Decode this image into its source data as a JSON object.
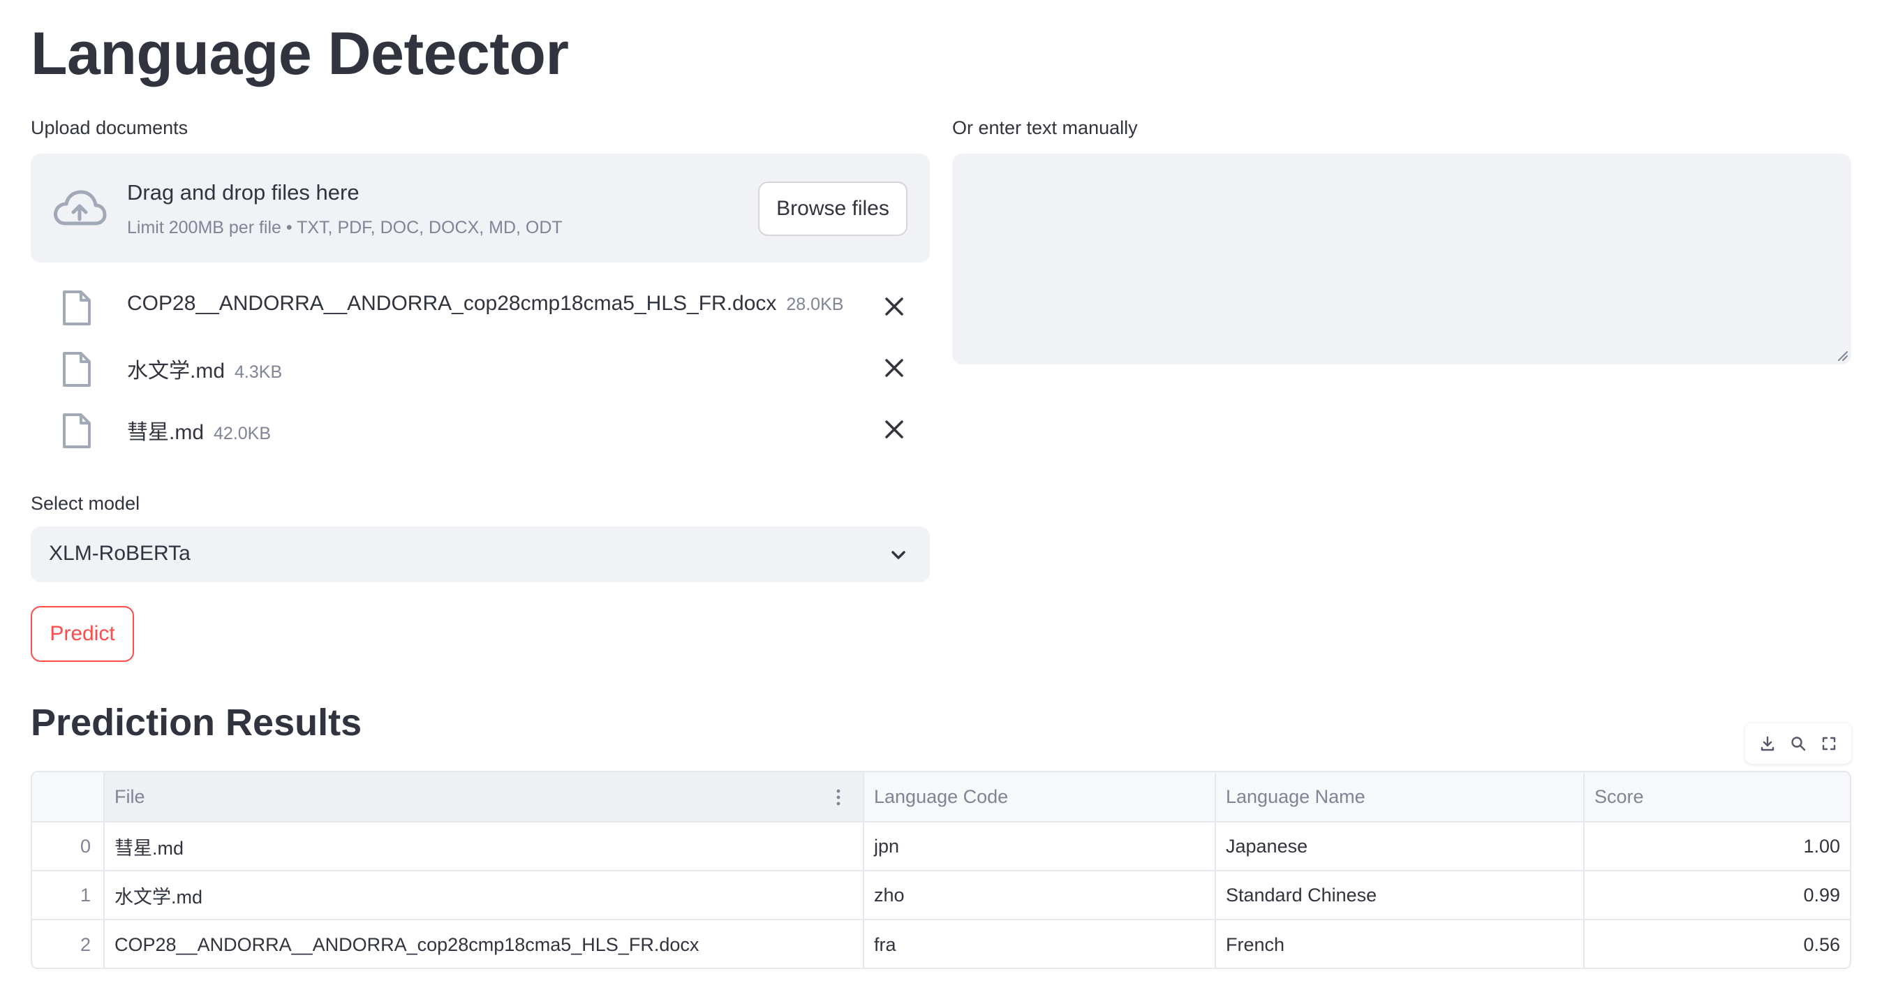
{
  "app": {
    "title": "Language Detector"
  },
  "upload": {
    "label": "Upload documents",
    "drop_text": "Drag and drop files here",
    "limit_text": "Limit 200MB per file • TXT, PDF, DOC, DOCX, MD, ODT",
    "browse_label": "Browse files",
    "icon": "cloud-upload-icon"
  },
  "files": [
    {
      "name": "COP28__ANDORRA__ANDORRA_cop28cmp18cma5_HLS_FR.docx",
      "size": "28.0KB"
    },
    {
      "name": "水文学.md",
      "size": "4.3KB"
    },
    {
      "name": "彗星.md",
      "size": "42.0KB"
    }
  ],
  "manual": {
    "label": "Or enter text manually",
    "value": ""
  },
  "model": {
    "label": "Select model",
    "selected": "XLM-RoBERTa"
  },
  "predict": {
    "label": "Predict"
  },
  "results": {
    "title": "Prediction Results",
    "columns": [
      "File",
      "Language Code",
      "Language Name",
      "Score"
    ],
    "rows": [
      {
        "index": "0",
        "file": "彗星.md",
        "code": "jpn",
        "name": "Japanese",
        "score": "1.00"
      },
      {
        "index": "1",
        "file": "水文学.md",
        "code": "zho",
        "name": "Standard Chinese",
        "score": "0.99"
      },
      {
        "index": "2",
        "file": "COP28__ANDORRA__ANDORRA_cop28cmp18cma5_HLS_FR.docx",
        "code": "fra",
        "name": "French",
        "score": "0.56"
      }
    ]
  },
  "colors": {
    "accent": "#ff4b4b",
    "text": "#31333f",
    "muted": "#808495",
    "input_bg": "#f0f2f6"
  }
}
